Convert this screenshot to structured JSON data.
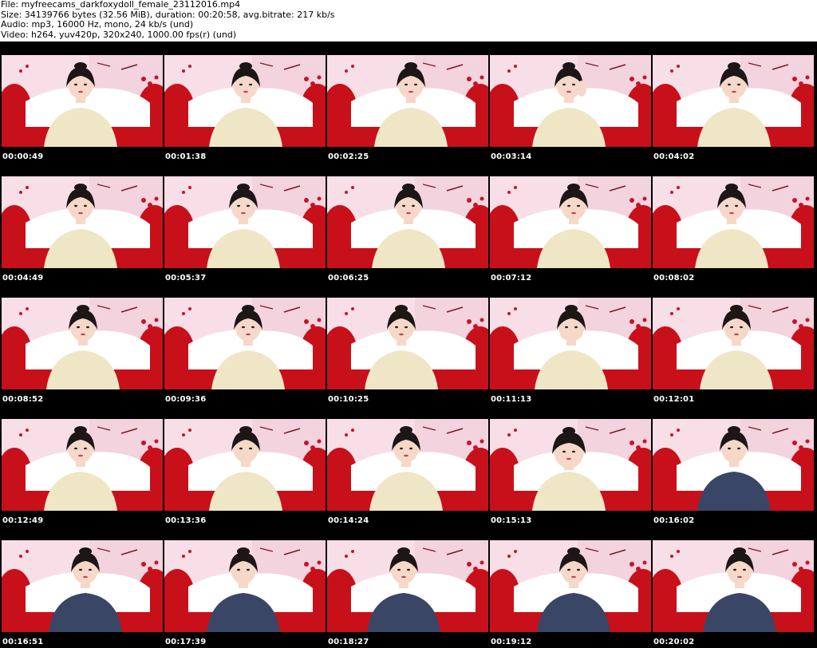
{
  "header": {
    "file": "File: myfreecams_darkfoxydoll_female_23112016.mp4",
    "size": "Size: 34139766 bytes (32.56 MiB), duration: 00:20:58, avg.bitrate: 217 kb/s",
    "audio": "Audio: mp3, 16000 Hz, mono, 24 kb/s (und)",
    "video": "Video: h264, yuv420p, 320x240, 1000.00 fps(r) (und)"
  },
  "thumbnails": [
    {
      "time": "00:00:49",
      "outfit": "sweater",
      "pose": "neutral"
    },
    {
      "time": "00:01:38",
      "outfit": "sweater",
      "pose": "neutral"
    },
    {
      "time": "00:02:25",
      "outfit": "sweater",
      "pose": "neutral"
    },
    {
      "time": "00:03:14",
      "outfit": "sweater",
      "pose": "phone"
    },
    {
      "time": "00:04:02",
      "outfit": "sweater",
      "pose": "neutral"
    },
    {
      "time": "00:04:49",
      "outfit": "sweater",
      "pose": "tilt"
    },
    {
      "time": "00:05:37",
      "outfit": "sweater",
      "pose": "neutral"
    },
    {
      "time": "00:06:25",
      "outfit": "sweater",
      "pose": "neutral"
    },
    {
      "time": "00:07:12",
      "outfit": "sweater",
      "pose": "neutral"
    },
    {
      "time": "00:08:02",
      "outfit": "sweater",
      "pose": "neutral"
    },
    {
      "time": "00:08:52",
      "outfit": "sweater",
      "pose": "neutral"
    },
    {
      "time": "00:09:36",
      "outfit": "sweater",
      "pose": "neutral"
    },
    {
      "time": "00:10:25",
      "outfit": "sweater",
      "pose": "tilt"
    },
    {
      "time": "00:11:13",
      "outfit": "sweater",
      "pose": "hands"
    },
    {
      "time": "00:12:01",
      "outfit": "sweater",
      "pose": "neutral"
    },
    {
      "time": "00:12:49",
      "outfit": "sweater",
      "pose": "neutral"
    },
    {
      "time": "00:13:36",
      "outfit": "sweater",
      "pose": "hand"
    },
    {
      "time": "00:14:24",
      "outfit": "sweater",
      "pose": "tilt"
    },
    {
      "time": "00:15:13",
      "outfit": "sweater",
      "pose": "close"
    },
    {
      "time": "00:16:02",
      "outfit": "print",
      "pose": "hand"
    },
    {
      "time": "00:16:51",
      "outfit": "print",
      "pose": "neutral"
    },
    {
      "time": "00:17:39",
      "outfit": "print",
      "pose": "hand"
    },
    {
      "time": "00:18:27",
      "outfit": "print",
      "pose": "tilt"
    },
    {
      "time": "00:19:12",
      "outfit": "print",
      "pose": "neutral"
    },
    {
      "time": "00:20:02",
      "outfit": "print",
      "pose": "side"
    }
  ],
  "colors": {
    "wall": "#f3d3dd",
    "wall_light": "#fbe7ee",
    "couch": "#c8101a",
    "pillow": "#ffffff",
    "sweater": "#efe6c6",
    "print_top": "#3a4666",
    "hair": "#1c1616",
    "skin": "#f6d8c8",
    "heart": "#c4142a"
  }
}
